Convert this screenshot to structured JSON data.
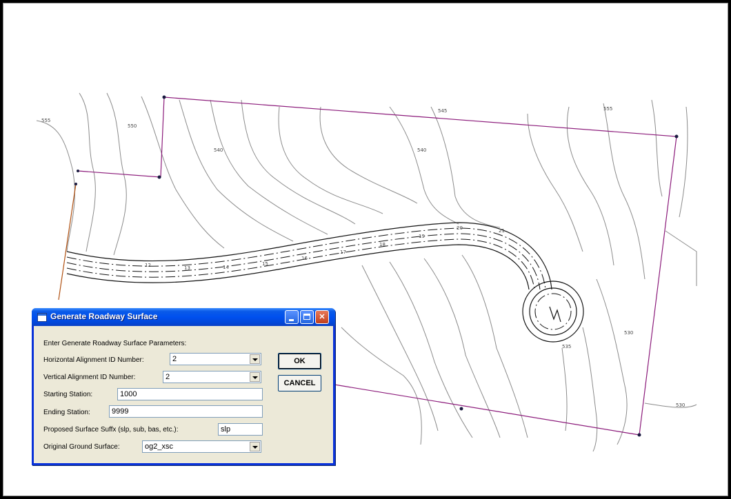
{
  "dialog": {
    "title": "Generate Roadway Surface",
    "prompt": "Enter Generate Roadway Surface Parameters:",
    "fields": {
      "horizontal": {
        "label": "Horizontal Alignment ID Number:",
        "value": "2"
      },
      "vertical": {
        "label": "Vertical Alignment ID Number:",
        "value": "2"
      },
      "starting": {
        "label": "Starting Station:",
        "value": "1000"
      },
      "ending": {
        "label": "Ending Station:",
        "value": "9999"
      },
      "suffix": {
        "label": "Proposed Surface Suffx (slp, sub, bas, etc.):",
        "value": "slp"
      },
      "ground": {
        "label": "Original Ground Surface:",
        "value": "og2_xsc"
      }
    },
    "buttons": {
      "ok": "OK",
      "cancel": "CANCEL"
    },
    "window_buttons": [
      "minimize-icon",
      "maximize-icon",
      "close-icon"
    ]
  },
  "map": {
    "station_labels": [
      "12",
      "13",
      "14",
      "15",
      "16",
      "17",
      "18",
      "19",
      "20",
      "21"
    ],
    "contour_labels": [
      "555",
      "550",
      "545",
      "540",
      "535",
      "530"
    ],
    "boundary_color": "#8b1a7a",
    "contour_color": "#8a8a8a"
  }
}
